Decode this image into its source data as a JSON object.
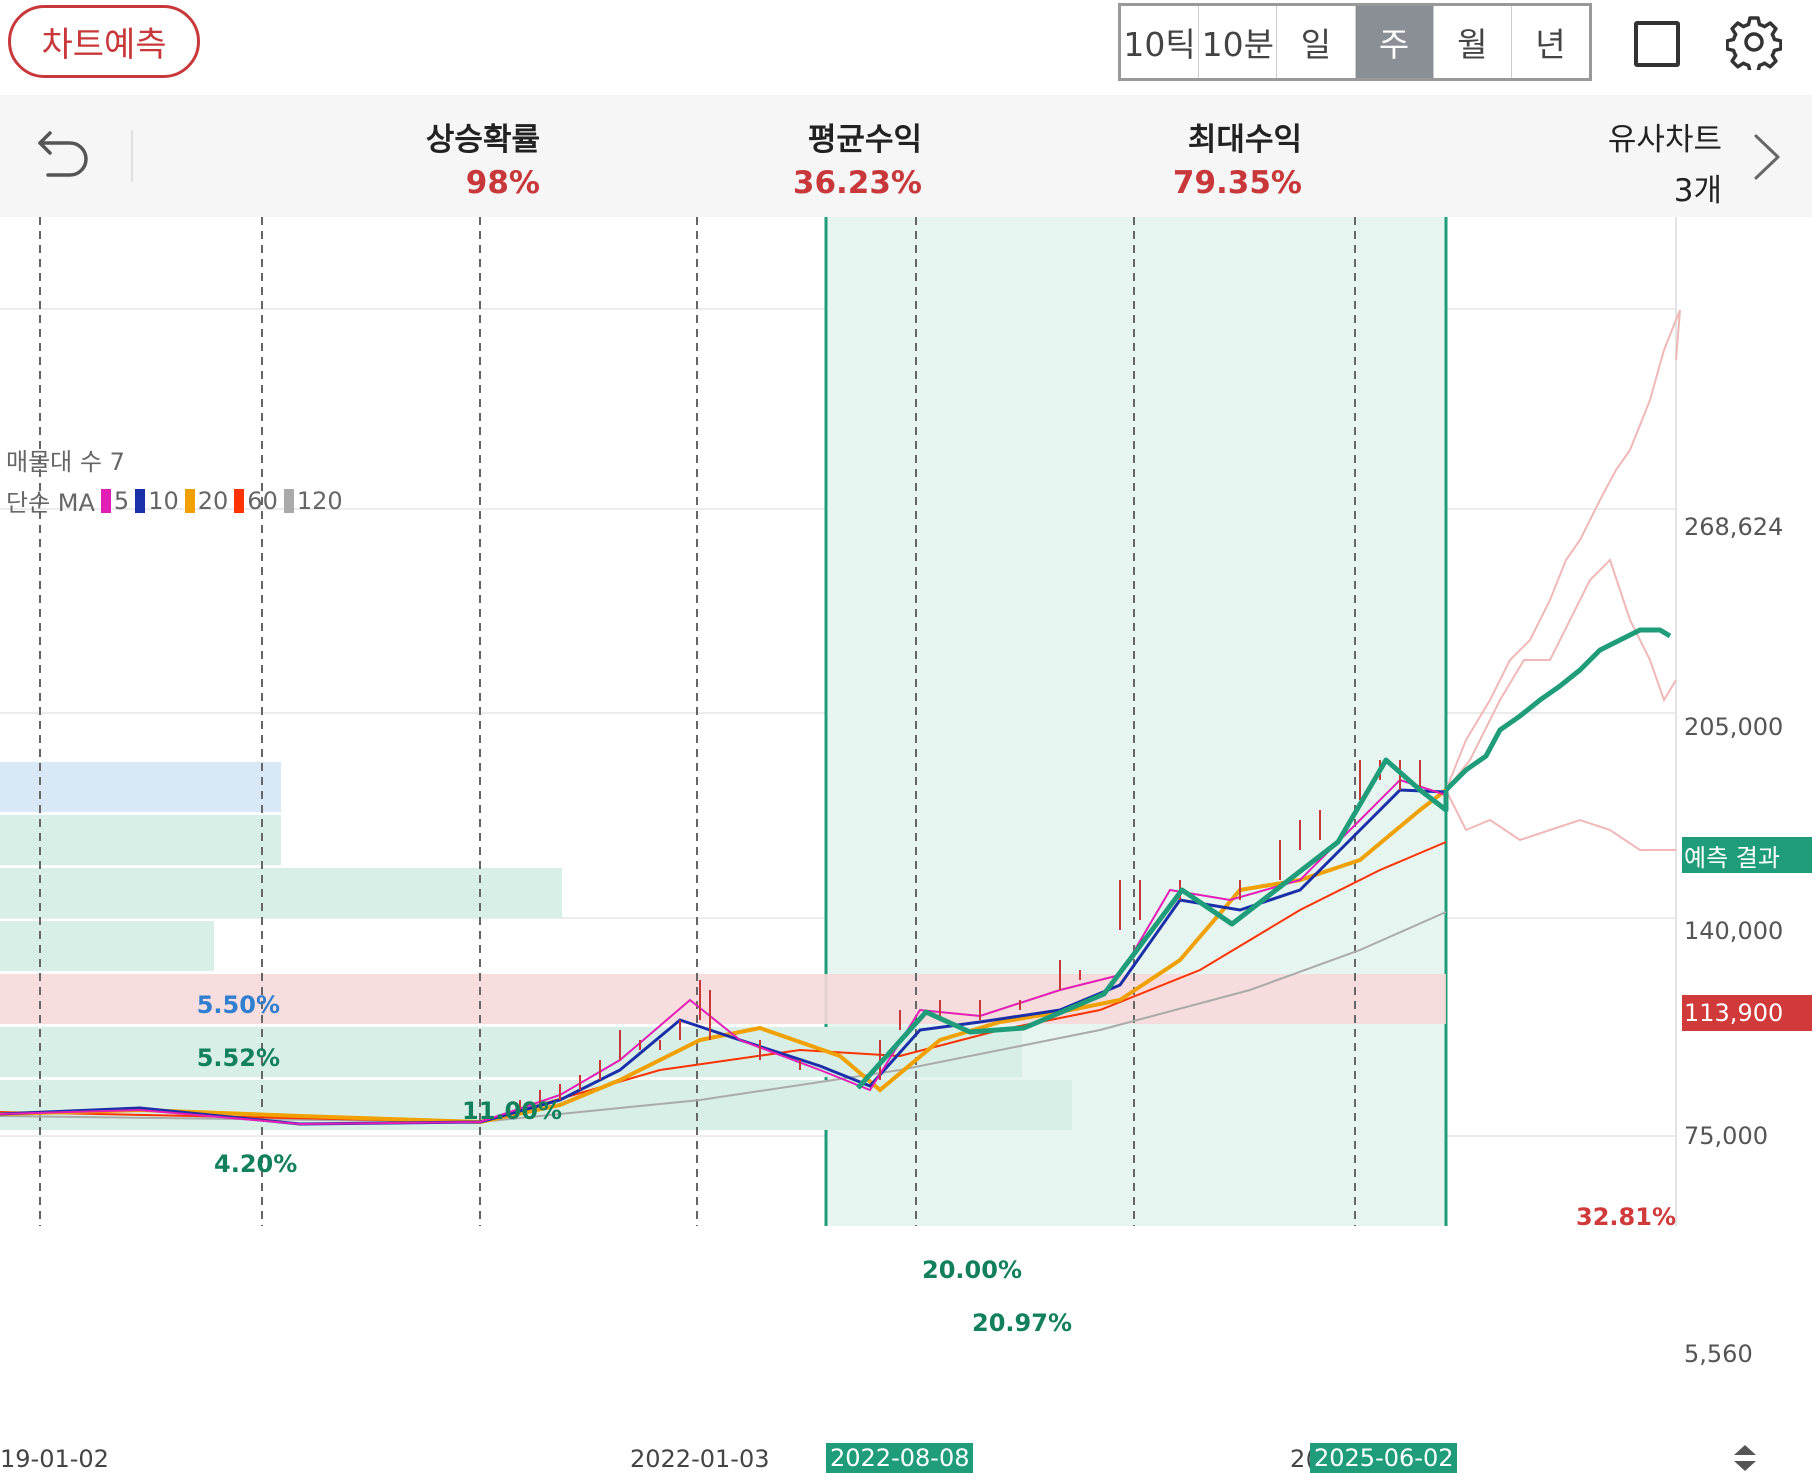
{
  "toolbar": {
    "predict_button": "차트예측",
    "period_tabs": [
      "10틱",
      "10분",
      "일",
      "주",
      "월",
      "년"
    ],
    "active_period": "주"
  },
  "stats": {
    "rise_probability": {
      "label": "상승확률",
      "value": "98%"
    },
    "average_return": {
      "label": "평균수익",
      "value": "36.23%"
    },
    "max_return": {
      "label": "최대수익",
      "value": "79.35%"
    },
    "similar_charts": {
      "label": "유사차트",
      "value": "3개"
    }
  },
  "legend": {
    "volume_profile": "매물대 수 7",
    "ma_prefix": "단순 MA",
    "ma_items": [
      {
        "label": "5",
        "color": "#e21fb5"
      },
      {
        "label": "10",
        "color": "#1a2fa8"
      },
      {
        "label": "20",
        "color": "#f0a000"
      },
      {
        "label": "60",
        "color": "#ff3300"
      },
      {
        "label": "120",
        "color": "#aaaaaa"
      }
    ]
  },
  "volume_profile": [
    {
      "label": "5.50%",
      "value": 5.5,
      "color": "#2f7fd0"
    },
    {
      "label": "5.52%",
      "value": 5.52,
      "color": "#12805c"
    },
    {
      "label": "11.00%",
      "value": 11.0,
      "color": "#12805c"
    },
    {
      "label": "4.20%",
      "value": 4.2,
      "color": "#12805c"
    },
    {
      "label": "32.81%",
      "value": 32.81,
      "color": "#d03a3a"
    },
    {
      "label": "20.00%",
      "value": 20.0,
      "color": "#12805c"
    },
    {
      "label": "20.97%",
      "value": 20.97,
      "color": "#12805c"
    }
  ],
  "price_axis": [
    "268,624",
    "205,000",
    "140,000",
    "75,000",
    "5,560"
  ],
  "tags": {
    "prediction": "예측 결과",
    "current_price": "113,900"
  },
  "date_axis": {
    "labels": [
      "19-01-02",
      "2022-01-03",
      "2("
    ],
    "highlight_start": "2022-08-08",
    "highlight_end": "2025-06-02"
  },
  "colors": {
    "accent_red": "#c8373a",
    "prediction_green": "#1f9d7a",
    "highlight_bg": "#e6f5f0"
  }
}
